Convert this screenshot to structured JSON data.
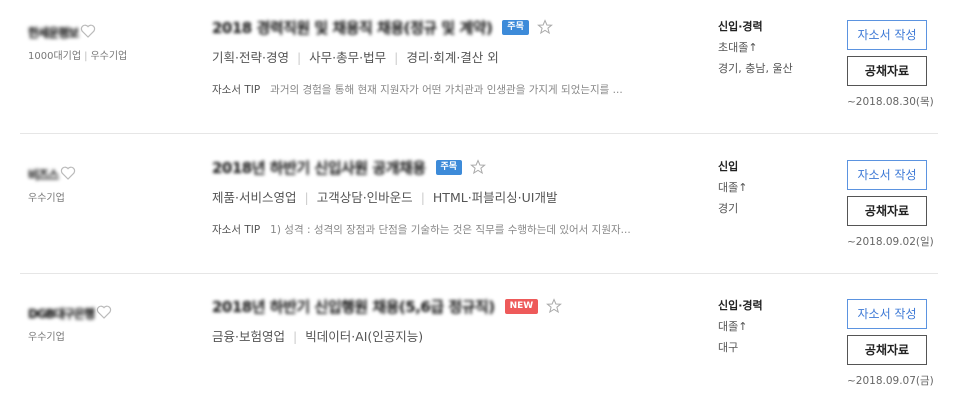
{
  "colors": {
    "focus_badge": "#3d8bd9",
    "new_badge": "#ee5a5a",
    "write_button": "#3d79d6",
    "divider": "#e6e6e6"
  },
  "tip_label": "자소서 TIP",
  "write_label": "자소서 작성",
  "info_label": "공채자료",
  "jobs": [
    {
      "company": "한세운평보",
      "company_meta": [
        "1000대기업",
        "우수기업"
      ],
      "title": "2018 경력직원 및 채용직 채용(정규 및 계약)",
      "badge": "주목",
      "categories": [
        "기획·전략·경영",
        "사무·총무·법무",
        "경리·회계·결산 외"
      ],
      "tip": "과거의 경험을 통해 현재 지원자가 어떤 가치관과 인생관을 가지게 되었는지를 ...",
      "career": "신입·경력",
      "education": "초대졸↑",
      "location": "경기, 충남, 울산",
      "deadline": "~2018.08.30(목)"
    },
    {
      "company": "비즈스",
      "company_meta": [
        "우수기업"
      ],
      "title": "2018년 하반기 신입사원 공개채용",
      "badge": "주목",
      "categories": [
        "제품·서비스영업",
        "고객상담·인바운드",
        "HTML·퍼블리싱·UI개발"
      ],
      "tip": "1) 성격 : 성격의 장점과 단점을 기술하는 것은 직무를 수행하는데 있어서 지원자...",
      "career": "신입",
      "education": "대졸↑",
      "location": "경기",
      "deadline": "~2018.09.02(일)"
    },
    {
      "company": "DGB대구은행",
      "company_meta": [
        "우수기업"
      ],
      "title": "2018년 하반기 신입행원 채용(5,6급 정규직)",
      "badge": "NEW",
      "categories": [
        "금융·보험영업",
        "빅데이터·AI(인공지능)"
      ],
      "tip": "",
      "career": "신입·경력",
      "education": "대졸↑",
      "location": "대구",
      "deadline": "~2018.09.07(금)"
    }
  ]
}
